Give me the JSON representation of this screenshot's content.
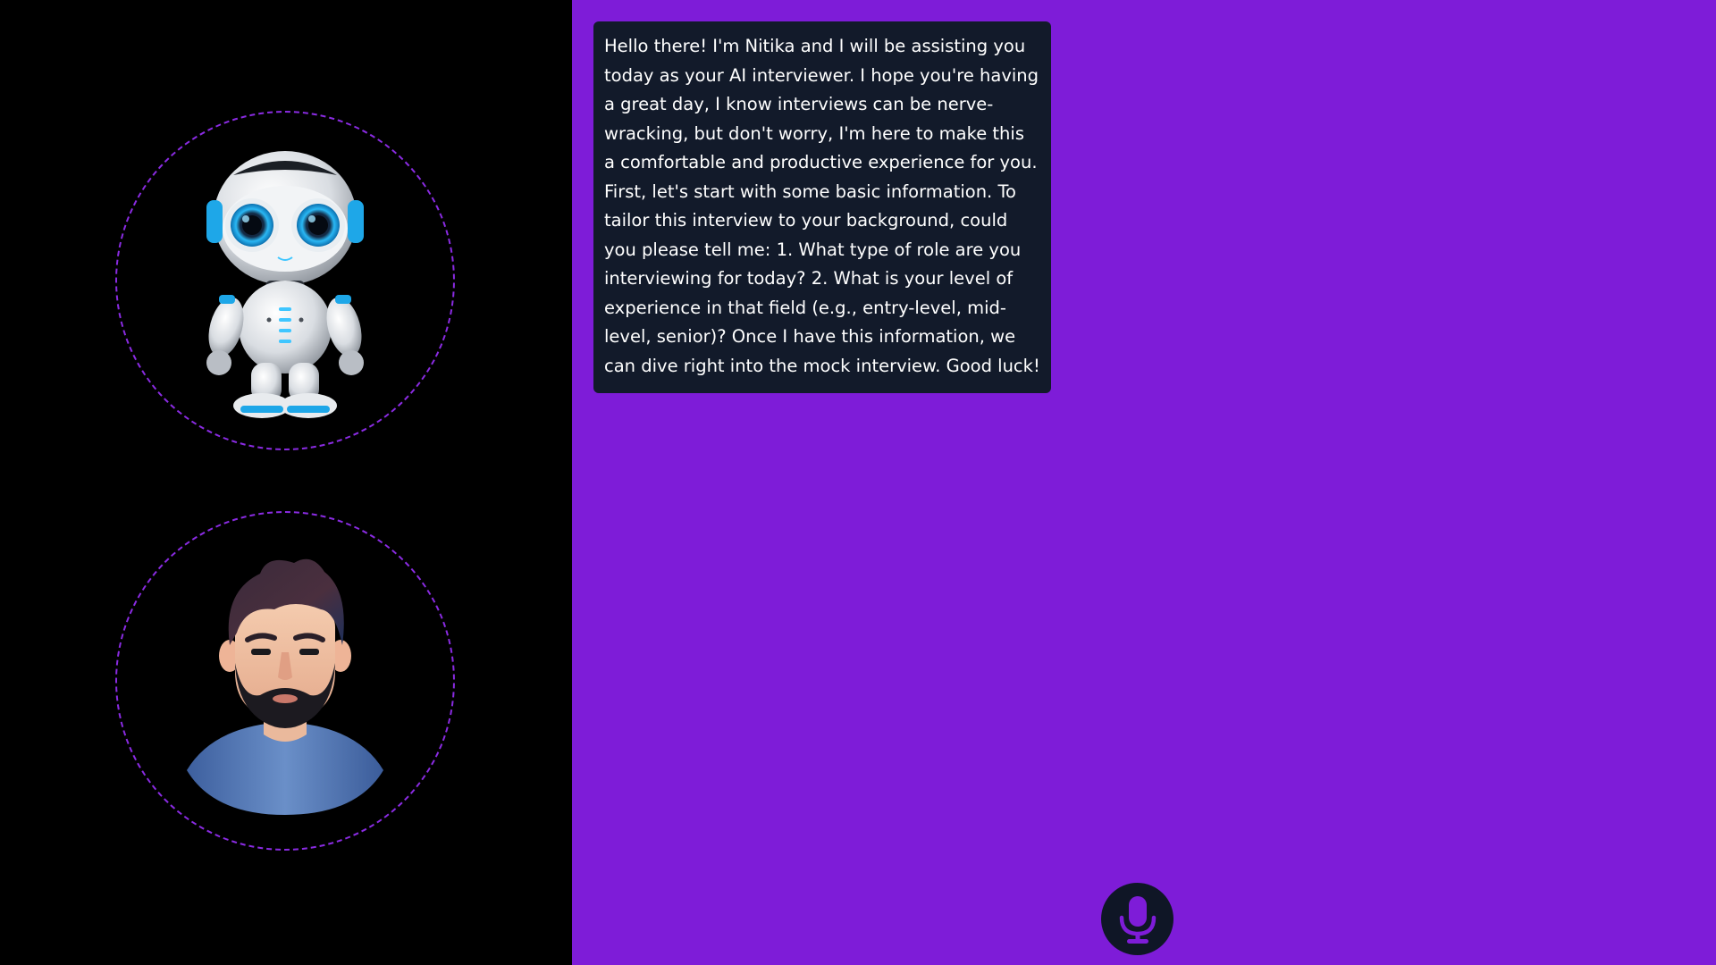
{
  "conversation": {
    "messages": [
      {
        "sender": "ai",
        "text": "Hello there! I'm Nitika and I will be assisting you today as your AI interviewer. I hope you're having a great day, I know interviews can be nerve-wracking, but don't worry, I'm here to make this a comfortable and productive experience for you. First, let's start with some basic information. To tailor this interview to your background, could you please tell me: 1. What type of role are you interviewing for today? 2. What is your level of experience in that field (e.g., entry-level, mid-level, senior)? Once I have this information, we can dive right into the mock interview. Good luck!"
      }
    ]
  },
  "avatars": {
    "ai": {
      "icon": "robot-avatar"
    },
    "user": {
      "icon": "bearded-man-avatar"
    }
  },
  "controls": {
    "mic": {
      "icon": "microphone-icon"
    }
  },
  "colors": {
    "sidebar_bg": "#000000",
    "main_bg": "#7e1cd8",
    "ring": "#8a2be2",
    "bubble_bg": "#121a2a",
    "mic_bg": "#0f1626",
    "mic_icon": "#7e1cd8"
  }
}
